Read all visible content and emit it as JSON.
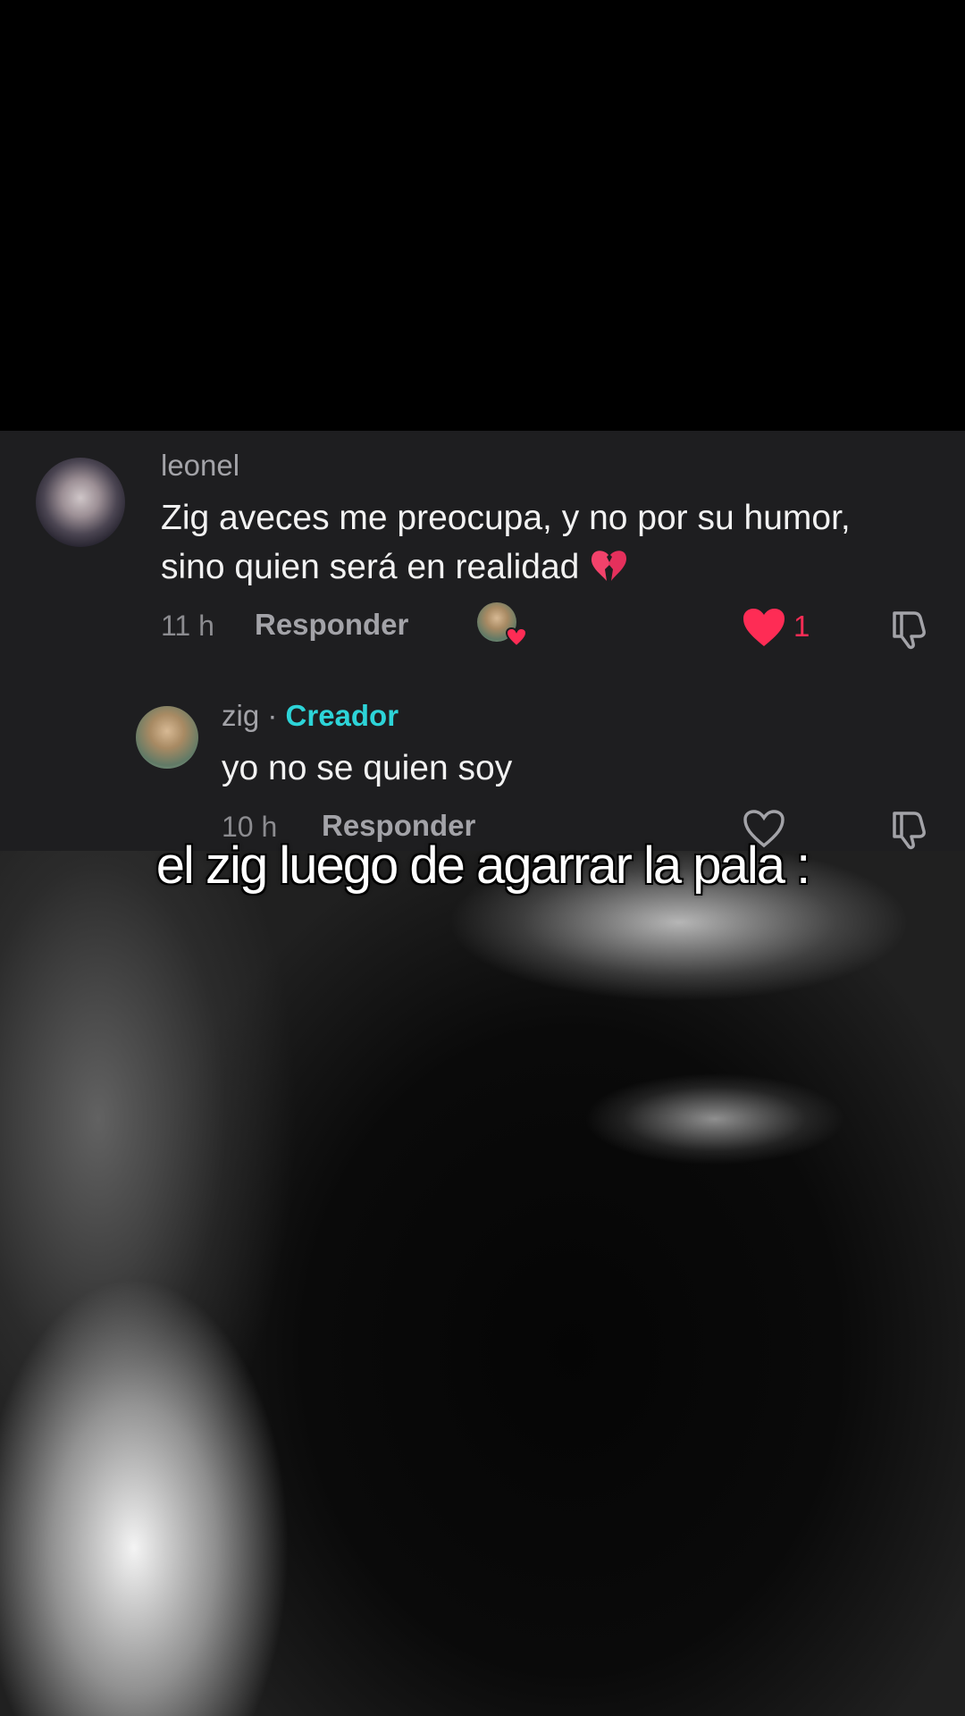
{
  "comments": [
    {
      "username": "leonel",
      "text": "Zig aveces me preocupa, y no por su humor, sino quien será en realidad",
      "emoji": "broken-heart-icon",
      "time": "11 h",
      "reply_label": "Responder",
      "likes": "1",
      "liked": true,
      "liked_by_creator": true
    },
    {
      "username": "zig",
      "separator": " · ",
      "badge": "Creador",
      "text": "yo no se quien soy",
      "time": "10 h",
      "reply_label": "Responder",
      "liked": false
    }
  ],
  "caption": "el zig luego de agarrar la pala :",
  "colors": {
    "panel_bg": "#1e1e20",
    "like_red": "#fe2c55",
    "creator_teal": "#2dd4d8"
  }
}
